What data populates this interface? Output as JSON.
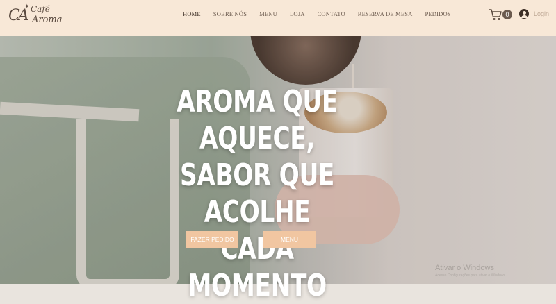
{
  "header": {
    "logo": {
      "monogram": "CA",
      "line1": "Café",
      "line2": "Aroma"
    },
    "nav": [
      {
        "label": "HOME",
        "active": true
      },
      {
        "label": "SOBRE NÓS"
      },
      {
        "label": "MENU"
      },
      {
        "label": "LOJA"
      },
      {
        "label": "CONTATO"
      },
      {
        "label": "RESERVA DE MESA"
      },
      {
        "label": "PEDIDOS"
      }
    ],
    "cart_icon": "shopping-cart-icon",
    "cart_count": "0",
    "login_icon": "user-avatar-icon",
    "login_label": "Login"
  },
  "hero": {
    "headline": "AROMA QUE AQUECE, SABOR QUE ACOLHE CADA MOMENTO",
    "buttons": {
      "order": "FAZER PEDIDO",
      "menu": "MENU"
    }
  },
  "watermark": {
    "title": "Ativar o Windows",
    "subtitle": "Acesse Configurações para ativar o Windows."
  },
  "colors": {
    "header_bg": "#f8e8d7",
    "button_bg": "#f1c6a1",
    "text_brown": "#6b5a4e"
  }
}
